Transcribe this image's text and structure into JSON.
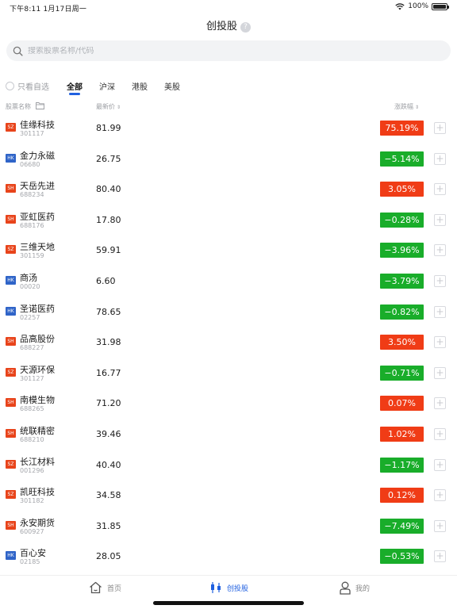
{
  "status_bar": {
    "time_date": "下午8:11   1月17日周一",
    "battery": "100%"
  },
  "header": {
    "title": "创投股",
    "help": "?"
  },
  "search": {
    "placeholder": "搜索股票名称/代码"
  },
  "filter": {
    "only_watchlist": "只看自选",
    "tabs": [
      "全部",
      "沪深",
      "港股",
      "美股"
    ],
    "active_tab": "全部"
  },
  "columns": {
    "name": "股票名称",
    "price": "最新价",
    "change": "涨跌幅",
    "sort_glyph": "⇕"
  },
  "colors": {
    "up": "#f03c16",
    "down": "#19ad2a",
    "accent": "#2060e0",
    "market_cn": "#e8441b",
    "market_hk": "#2f64c8"
  },
  "stocks": [
    {
      "market": "SZ",
      "name": "佳缘科技",
      "code": "301117",
      "price": "81.99",
      "change": "75.19%",
      "dir": "up"
    },
    {
      "market": "HK",
      "name": "金力永磁",
      "code": "06680",
      "price": "26.75",
      "change": "−5.14%",
      "dir": "down"
    },
    {
      "market": "SH",
      "name": "天岳先进",
      "code": "688234",
      "price": "80.40",
      "change": "3.05%",
      "dir": "up"
    },
    {
      "market": "SH",
      "name": "亚虹医药",
      "code": "688176",
      "price": "17.80",
      "change": "−0.28%",
      "dir": "down"
    },
    {
      "market": "SZ",
      "name": "三维天地",
      "code": "301159",
      "price": "59.91",
      "change": "−3.96%",
      "dir": "down"
    },
    {
      "market": "HK",
      "name": "商汤",
      "code": "00020",
      "price": "6.60",
      "change": "−3.79%",
      "dir": "down"
    },
    {
      "market": "HK",
      "name": "圣诺医药",
      "code": "02257",
      "price": "78.65",
      "change": "−0.82%",
      "dir": "down"
    },
    {
      "market": "SH",
      "name": "品高股份",
      "code": "688227",
      "price": "31.98",
      "change": "3.50%",
      "dir": "up"
    },
    {
      "market": "SZ",
      "name": "天源环保",
      "code": "301127",
      "price": "16.77",
      "change": "−0.71%",
      "dir": "down"
    },
    {
      "market": "SH",
      "name": "南模生物",
      "code": "688265",
      "price": "71.20",
      "change": "0.07%",
      "dir": "up"
    },
    {
      "market": "SH",
      "name": "统联精密",
      "code": "688210",
      "price": "39.46",
      "change": "1.02%",
      "dir": "up"
    },
    {
      "market": "SZ",
      "name": "长江材料",
      "code": "001296",
      "price": "40.40",
      "change": "−1.17%",
      "dir": "down"
    },
    {
      "market": "SZ",
      "name": "凯旺科技",
      "code": "301182",
      "price": "34.58",
      "change": "0.12%",
      "dir": "up"
    },
    {
      "market": "SH",
      "name": "永安期货",
      "code": "600927",
      "price": "31.85",
      "change": "−7.49%",
      "dir": "down"
    },
    {
      "market": "HK",
      "name": "百心安",
      "code": "02185",
      "price": "28.05",
      "change": "−0.53%",
      "dir": "down"
    }
  ],
  "add_glyph": "+",
  "bottom_tabs": [
    {
      "label": "首页",
      "icon": "home-icon"
    },
    {
      "label": "创投股",
      "icon": "candlestick-icon",
      "active": true
    },
    {
      "label": "我的",
      "icon": "person-icon"
    }
  ]
}
